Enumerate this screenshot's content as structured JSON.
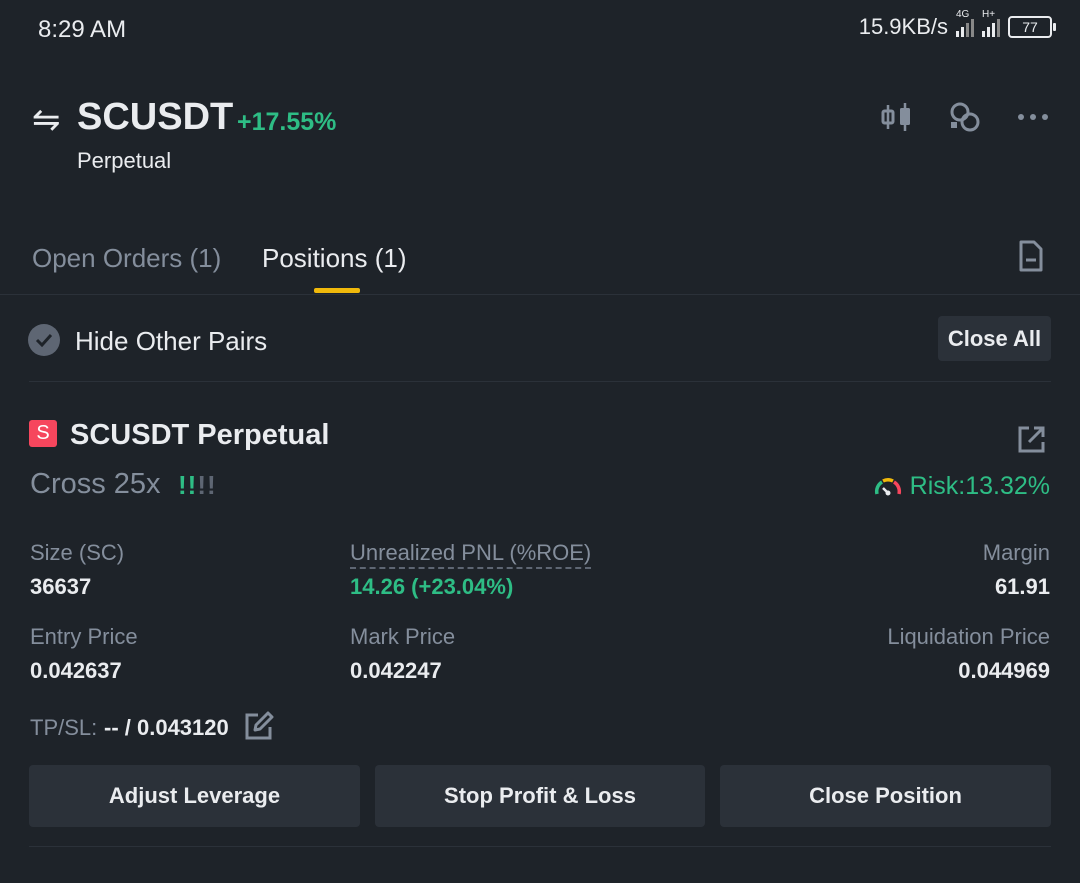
{
  "status_bar": {
    "time": "8:29 AM",
    "network_speed": "15.9KB/s",
    "sim1_label": "4G",
    "sim2_label": "H+",
    "battery": "77"
  },
  "header": {
    "symbol": "SCUSDT",
    "change_pct": "+17.55%",
    "contract_type": "Perpetual",
    "icons": [
      "candlestick-icon",
      "link-icon",
      "more-icon"
    ]
  },
  "tabs": [
    {
      "label": "Open Orders (1)",
      "active": false
    },
    {
      "label": "Positions (1)",
      "active": true
    }
  ],
  "filter": {
    "hide_other_pairs_label": "Hide Other Pairs",
    "hide_other_pairs_checked": true,
    "close_all_label": "Close All"
  },
  "position": {
    "side_badge": "S",
    "title": "SCUSDT Perpetual",
    "margin_mode": "Cross 25x",
    "adl_indicator": "!!!!",
    "risk_label": "Risk:13.32%",
    "fields": {
      "size_label": "Size (SC)",
      "size_value": "36637",
      "pnl_label": "Unrealized PNL (%ROE)",
      "pnl_value": "14.26 (+23.04%)",
      "margin_label": "Margin",
      "margin_value": "61.91",
      "entry_label": "Entry Price",
      "entry_value": "0.042637",
      "mark_label": "Mark Price",
      "mark_value": "0.042247",
      "liq_label": "Liquidation Price",
      "liq_value": "0.044969"
    },
    "tpsl_label": "TP/SL:",
    "tpsl_value": "-- / 0.043120",
    "buttons": {
      "adjust_leverage": "Adjust Leverage",
      "stop_profit_loss": "Stop Profit & Loss",
      "close_position": "Close Position"
    }
  },
  "colors": {
    "background": "#1e2329",
    "positive": "#2ebd85",
    "negative": "#f6465d",
    "accent": "#f0b90b",
    "muted": "#848e9c"
  }
}
